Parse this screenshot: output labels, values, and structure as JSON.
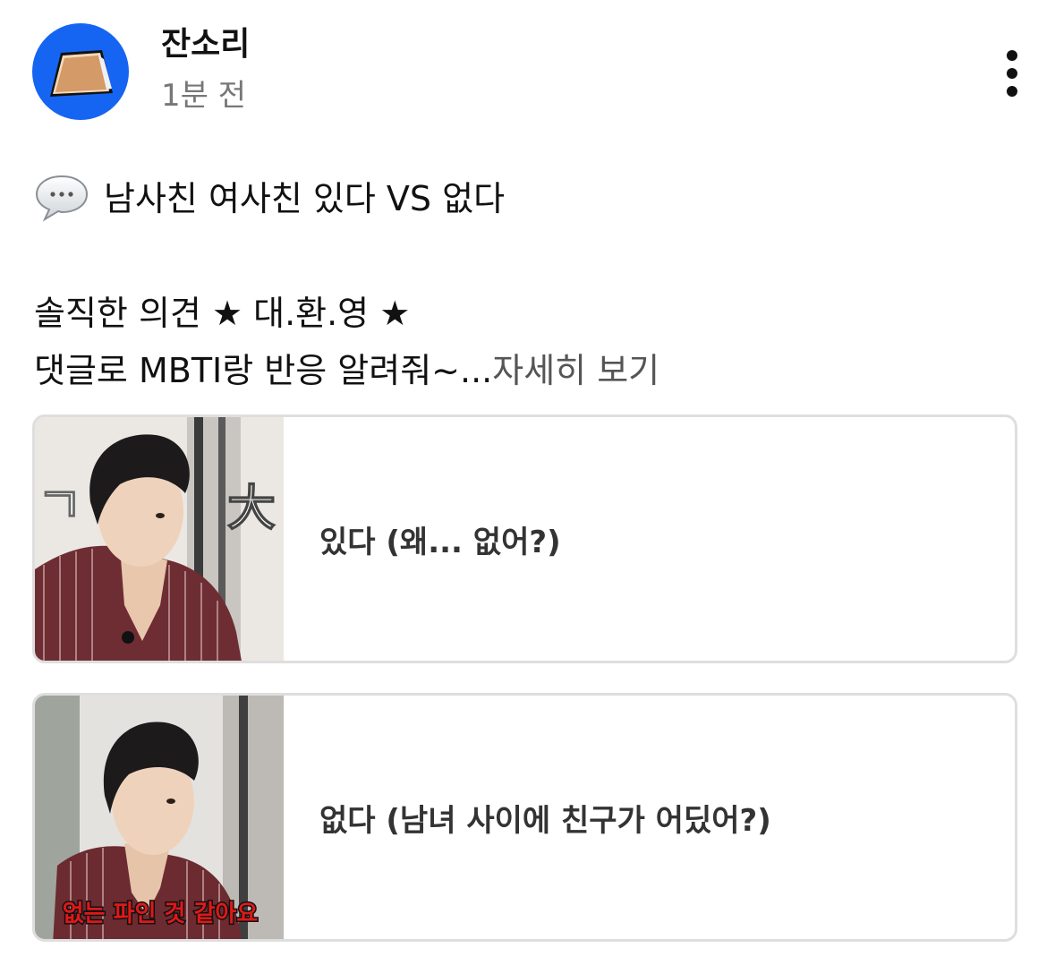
{
  "header": {
    "channel_name": "잔소리",
    "time_ago": "1분 전"
  },
  "post": {
    "line1": "남사친 여사친 있다 VS 없다",
    "line2": "솔직한 의견 ★ 대.환.영 ★",
    "line3": "댓글로 MBTI랑 반응 알려줘~...",
    "read_more": "자세히 보기"
  },
  "poll": {
    "options": [
      {
        "label": "있다 (왜... 없어?)",
        "thumb_overlay_left": "ㄱ",
        "thumb_overlay_right": "大"
      },
      {
        "label": "없다 (남녀 사이에 친구가 어딨어?)",
        "thumb_caption": "없는 파인 것 같아요"
      }
    ]
  },
  "colors": {
    "avatar_bg": "#1565f2",
    "muted_text": "#777777",
    "border": "#dedede",
    "caption_red": "#e01818"
  }
}
